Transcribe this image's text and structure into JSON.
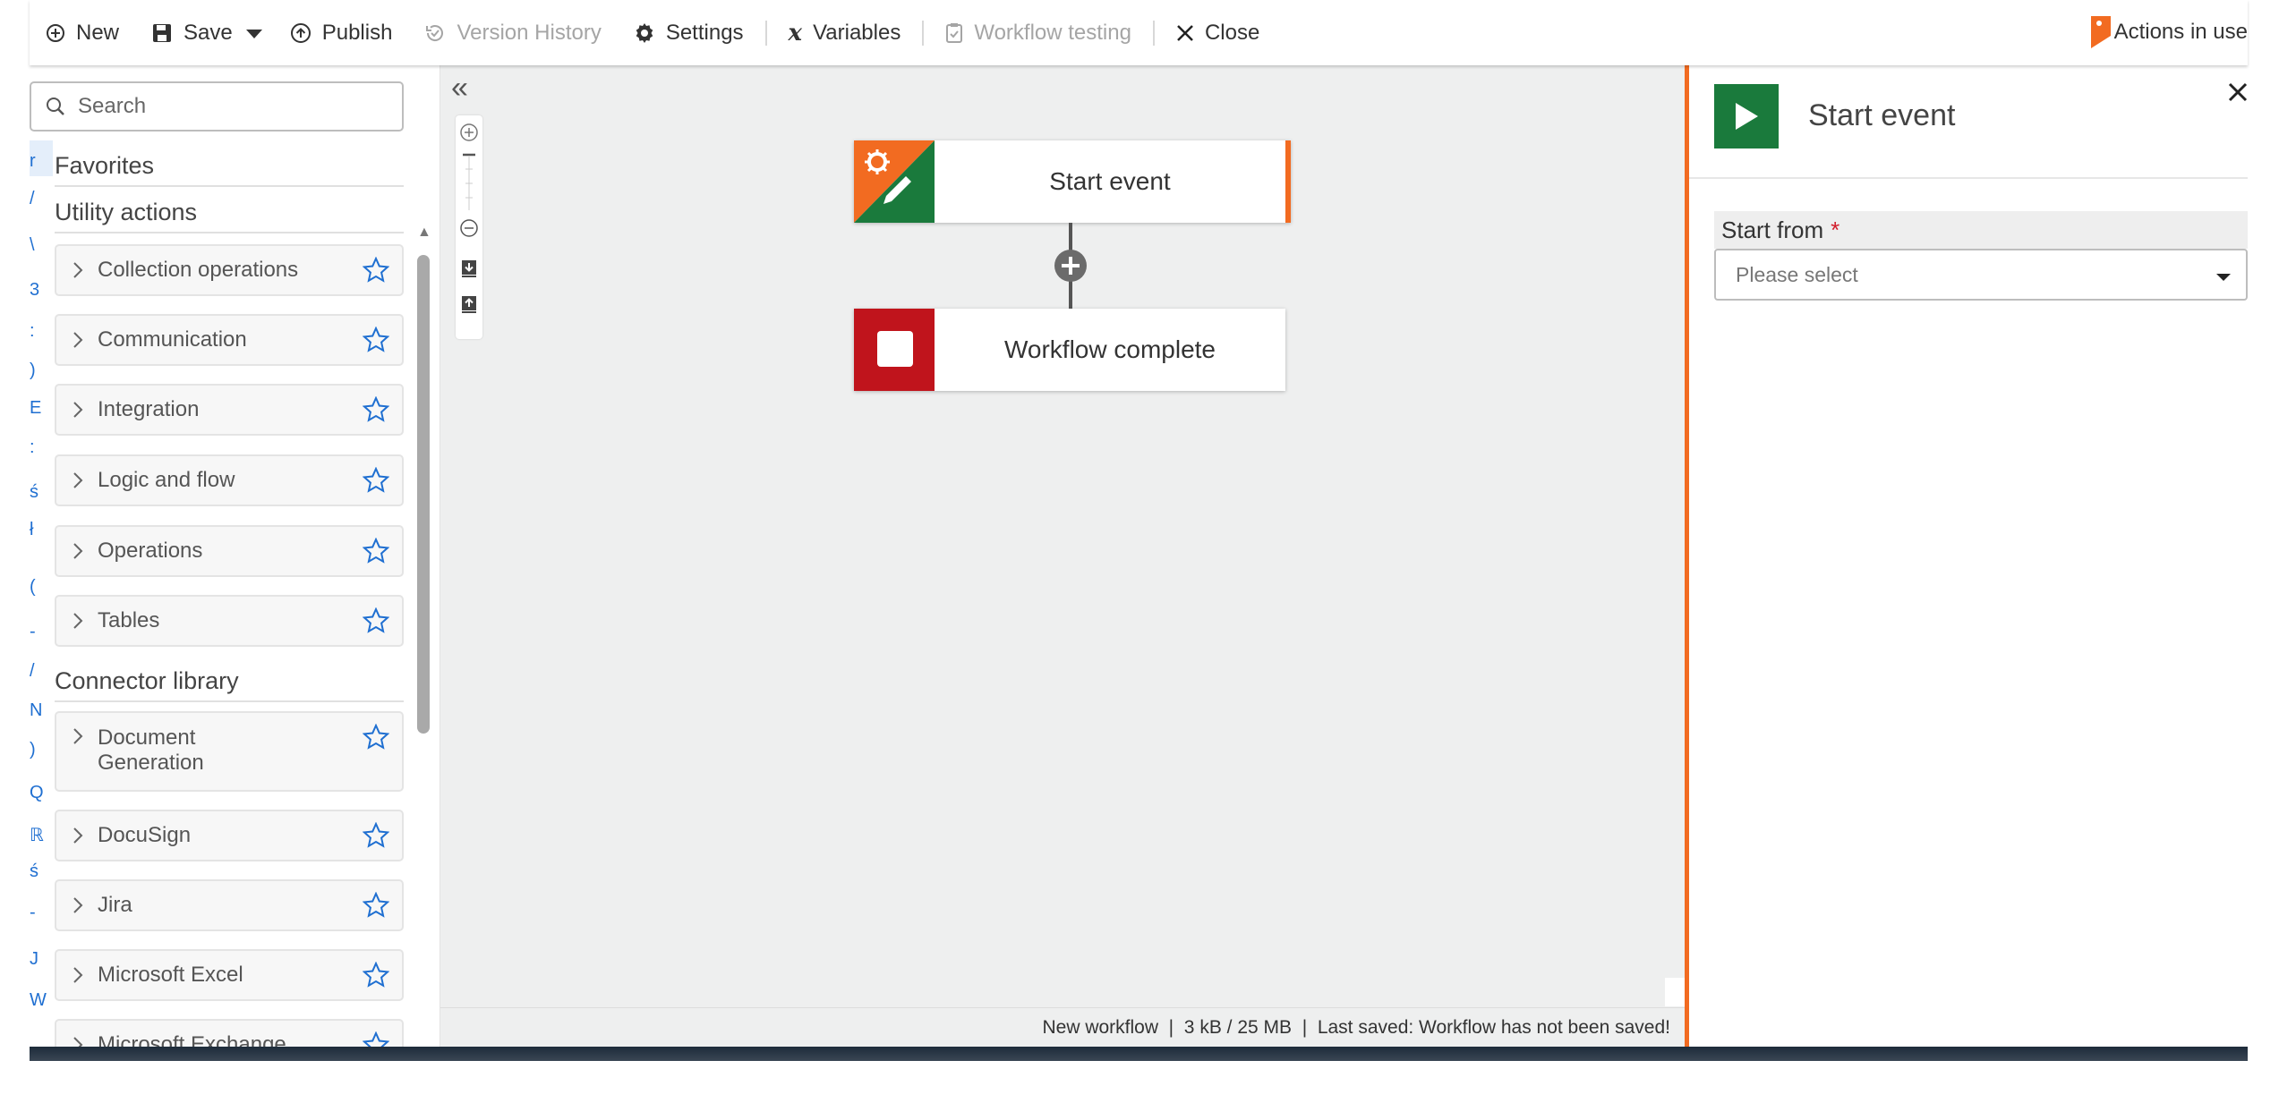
{
  "toolbar": {
    "new_label": "New",
    "save_label": "Save",
    "publish_label": "Publish",
    "version_history_label": "Version History",
    "settings_label": "Settings",
    "variables_label": "Variables",
    "workflow_testing_label": "Workflow testing",
    "close_label": "Close",
    "actions_in_use_label": "Actions in use"
  },
  "sidebar": {
    "search_placeholder": "Search",
    "alpha_letters": [
      "r",
      "/",
      "\\",
      "3",
      ":",
      ")",
      "E",
      ":",
      "ś",
      "ł",
      "(",
      "-",
      "/",
      "Ν",
      ")",
      "Q",
      "ℝ",
      "ś",
      "-",
      "J",
      "W"
    ],
    "favorites_label": "Favorites",
    "utility_actions_label": "Utility actions",
    "utility_items": [
      {
        "label": "Collection operations"
      },
      {
        "label": "Communication"
      },
      {
        "label": "Integration"
      },
      {
        "label": "Logic and flow"
      },
      {
        "label": "Operations"
      },
      {
        "label": "Tables"
      }
    ],
    "connector_library_label": "Connector library",
    "connector_items": [
      {
        "label": "Document Generation"
      },
      {
        "label": "DocuSign"
      },
      {
        "label": "Jira"
      },
      {
        "label": "Microsoft Excel"
      },
      {
        "label": "Microsoft Exchange"
      }
    ]
  },
  "canvas": {
    "start_node_label": "Start event",
    "end_node_label": "Workflow complete"
  },
  "status_bar": {
    "text": "New workflow  |  3 kB / 25 MB  |  Last saved: Workflow has not been saved!"
  },
  "config_panel": {
    "title": "Start event",
    "start_from_label": "Start from",
    "required_marker": "*",
    "select_placeholder": "Please select"
  },
  "colors": {
    "accent_orange": "#f26b21",
    "start_green": "#1a7a3c",
    "end_red": "#c0141c",
    "link_blue": "#1f6fd1"
  }
}
